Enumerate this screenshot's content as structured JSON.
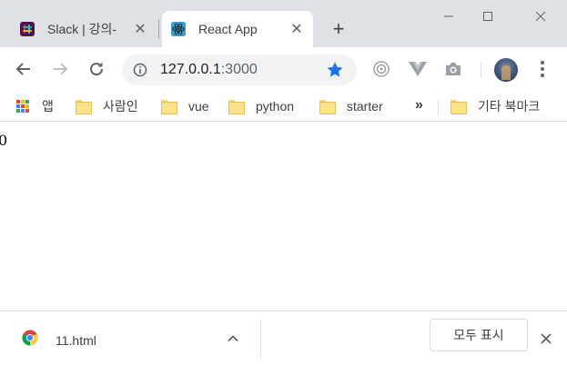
{
  "browser": {
    "tabs": [
      {
        "title": "Slack | 강의-",
        "active": false,
        "icon": "slack-icon"
      },
      {
        "title": "React App",
        "active": true,
        "icon": "react-icon"
      }
    ],
    "close_glyph": "✕",
    "newtab_glyph": "+",
    "window_controls": [
      "minimize-icon",
      "maximize-icon",
      "close-icon"
    ]
  },
  "toolbar": {
    "url_host": "127.0.0.1",
    "url_port": ":3000",
    "bookmarked": true,
    "accent_color": "#1a73e8",
    "extensions": [
      "recording-extension-icon",
      "vue-devtools-icon",
      "camera-extension-icon"
    ]
  },
  "bookmarks": {
    "apps_label": "앱",
    "items": [
      "사람인",
      "vue",
      "python",
      "starter"
    ],
    "more_glyph": "»",
    "other_label": "기타 북마크"
  },
  "page": {
    "text": "0"
  },
  "downloads": {
    "file_name": "11.html",
    "file_icon": "chrome-icon",
    "show_all_label": "모두 표시"
  }
}
